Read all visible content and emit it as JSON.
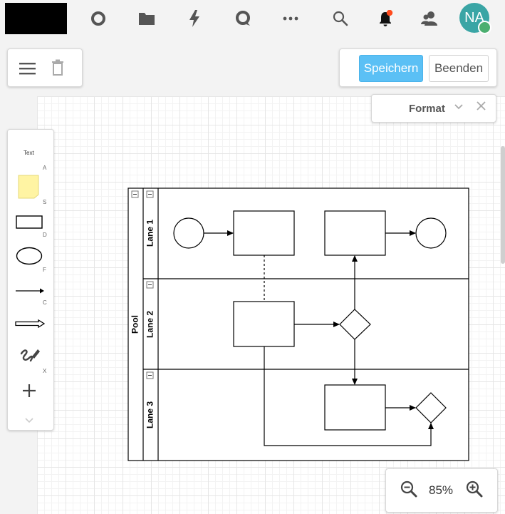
{
  "topbar": {
    "icons": [
      "circle-icon",
      "folder-icon",
      "lightning-icon",
      "chat-icon",
      "more-icon",
      "search-icon",
      "bell-icon",
      "users-icon"
    ],
    "avatar_initials": "NA",
    "notification_color": "#ff4a1c"
  },
  "toolbar": {
    "save_label": "Speichern",
    "exit_label": "Beenden"
  },
  "format_panel": {
    "title": "Format"
  },
  "shapes": {
    "text_label": "Text",
    "hints": [
      "A",
      "S",
      "D",
      "F",
      "C",
      "X"
    ]
  },
  "diagram": {
    "pool_label": "Pool",
    "lanes": [
      "Lane 1",
      "Lane 2",
      "Lane 3"
    ]
  },
  "zoom": {
    "value": "85%"
  },
  "colors": {
    "primary": "#5bc0f5",
    "avatar": "#3aa5a5",
    "status": "#4caf70"
  }
}
